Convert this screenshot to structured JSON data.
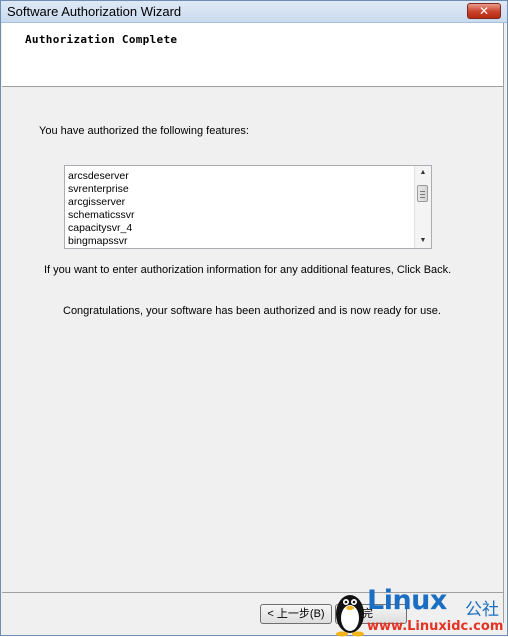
{
  "window": {
    "title": "Software Authorization Wizard",
    "close_glyph": "✕"
  },
  "header": {
    "heading": "Authorization Complete"
  },
  "main": {
    "intro_text": "You have authorized the following features:",
    "features": [
      "arcsdeserver",
      "svrenterprise",
      "arcgisserver",
      "schematicssvr",
      "capacitysvr_4",
      "bingmapssvr"
    ],
    "additional_text": "If you want to enter authorization information for any additional features, Click Back.",
    "congrats_text": "Congratulations, your software has been authorized and is now ready for use."
  },
  "footer": {
    "back_label": "< 上一步(B)",
    "finish_label": "完"
  },
  "watermark": {
    "brand": "Linux",
    "cn": "公社",
    "url": "www.Linuxidc.com"
  },
  "icons": {
    "scroll_up": "▲",
    "scroll_down": "▼"
  }
}
